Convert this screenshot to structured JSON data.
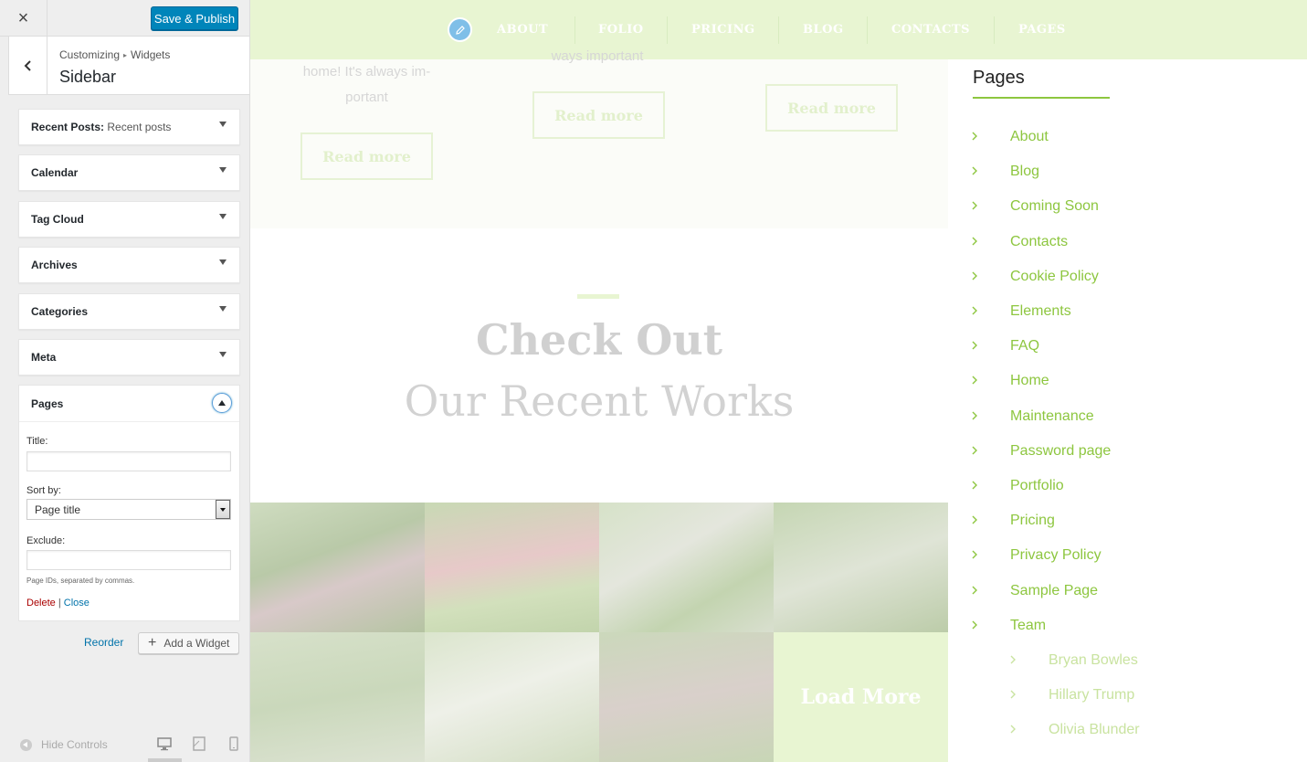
{
  "customizer": {
    "close_label": "×",
    "save_label": "Save & Publish",
    "breadcrumb": {
      "parent": "Customizing",
      "child": "Widgets"
    },
    "section_title": "Sidebar",
    "widgets": [
      {
        "title": "Recent Posts:",
        "subtitle": "Recent posts"
      },
      {
        "title": "Calendar",
        "subtitle": ""
      },
      {
        "title": "Tag Cloud",
        "subtitle": ""
      },
      {
        "title": "Archives",
        "subtitle": ""
      },
      {
        "title": "Categories",
        "subtitle": ""
      },
      {
        "title": "Meta",
        "subtitle": ""
      }
    ],
    "open_widget": {
      "title": "Pages",
      "title_label": "Title:",
      "title_value": "",
      "sort_label": "Sort by:",
      "sort_value": "Page title",
      "exclude_label": "Exclude:",
      "exclude_value": "",
      "hint": "Page IDs, separated by commas.",
      "delete_label": "Delete",
      "separator": "|",
      "close_label": "Close"
    },
    "reorder_label": "Reorder",
    "add_widget_label": "Add a Widget",
    "hide_controls_label": "Hide Controls"
  },
  "preview": {
    "nav": [
      "ABOUT",
      "FOLIO",
      "PRICING",
      "BLOG",
      "CONTACTS",
      "PAGES"
    ],
    "posts": [
      {
        "excerpt_line1": "home! It's always im-",
        "excerpt_line2": "portant",
        "read_more": "Read more"
      },
      {
        "excerpt_line1": "ways important",
        "excerpt_line2": "",
        "read_more": "Read more"
      },
      {
        "excerpt_line1": "",
        "excerpt_line2": "",
        "read_more": "Read more"
      }
    ],
    "works_heading_bold": "Check Out",
    "works_heading_light": "Our Recent Works",
    "load_more": "Load More",
    "sidebar_title": "Pages",
    "pages": [
      "About",
      "Blog",
      "Coming Soon",
      "Contacts",
      "Cookie Policy",
      "Elements",
      "FAQ",
      "Home",
      "Maintenance",
      "Password page",
      "Portfolio",
      "Pricing",
      "Privacy Policy",
      "Sample Page",
      "Team"
    ],
    "team_children": [
      "Bryan Bowles",
      "Hillary Trump",
      "Olivia Blunder"
    ]
  },
  "colors": {
    "accent_green": "#8dc63f",
    "nav_bg": "#e8f5d2",
    "wp_blue": "#0085ba",
    "delete_red": "#aa0000"
  }
}
